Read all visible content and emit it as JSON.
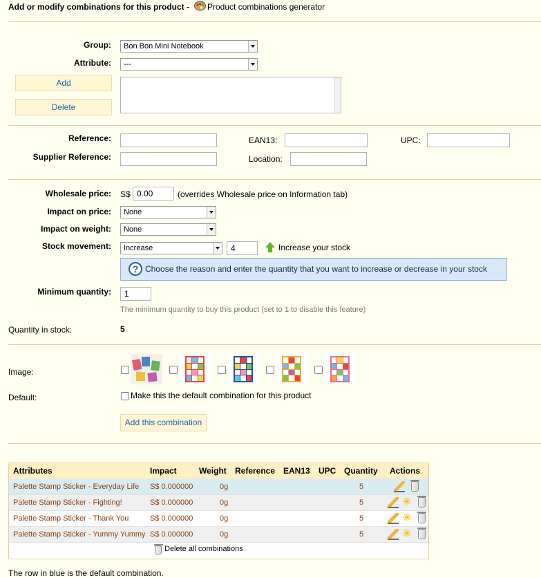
{
  "header": {
    "title": "Add or modify combinations for this product -",
    "generator_link": "Product combinations generator"
  },
  "attributes_section": {
    "group_label": "Group:",
    "group_value": "Bon Bon Mini Notebook",
    "attribute_label": "Attribute:",
    "attribute_value": "---",
    "add_button": "Add",
    "delete_button": "Delete"
  },
  "references": {
    "reference_label": "Reference:",
    "ean13_label": "EAN13:",
    "upc_label": "UPC:",
    "supplier_reference_label": "Supplier Reference:",
    "location_label": "Location:"
  },
  "pricing": {
    "wholesale_label": "Wholesale price:",
    "currency": "S$",
    "wholesale_value": "0.00",
    "wholesale_note": "(overrides Wholesale price on Information tab)",
    "impact_price_label": "Impact on price:",
    "impact_price_value": "None",
    "impact_weight_label": "Impact on weight:",
    "impact_weight_value": "None",
    "stock_movement_label": "Stock movement:",
    "stock_movement_value": "Increase",
    "stock_quantity_value": "4",
    "increase_stock_text": "Increase your stock",
    "hint_text": "Choose the reason and enter the quantity that you want to increase or decrease in your stock",
    "min_quantity_label": "Minimum quantity:",
    "min_quantity_value": "1",
    "min_quantity_help": "The minimum quantity to buy this product (set to 1 to disable this feature)",
    "qty_in_stock_label": "Quantity in stock:",
    "qty_in_stock_value": "5"
  },
  "images_section": {
    "image_label": "Image:",
    "default_label": "Default:",
    "default_checkbox_text": "Make this the default combination for this product",
    "add_combination_button": "Add this combination"
  },
  "table": {
    "headers": [
      "Attributes",
      "Impact",
      "Weight",
      "Reference",
      "EAN13",
      "UPC",
      "Quantity",
      "Actions"
    ],
    "rows": [
      {
        "attributes": "Palette Stamp Sticker - Everyday Life",
        "impact": "S$ 0.000000",
        "weight": "0g",
        "quantity": "5"
      },
      {
        "attributes": "Palette Stamp Sticker - Fighting!",
        "impact": "S$ 0.000000",
        "weight": "0g",
        "quantity": "5"
      },
      {
        "attributes": "Palette Stamp Sticker - Thank You",
        "impact": "S$ 0.000000",
        "weight": "0g",
        "quantity": "5"
      },
      {
        "attributes": "Palette Stamp Sticker - Yummy Yummy",
        "impact": "S$ 0.000000",
        "weight": "0g",
        "quantity": "5"
      }
    ],
    "delete_all": "Delete all combinations"
  },
  "footer_note": "The row in blue is the default combination.",
  "colors": {
    "background": "#fffff0",
    "accent_link": "#2265b2",
    "divider": "#e2cda0",
    "default_row": "#d9ecf2",
    "table_text": "#8a4316"
  },
  "icons": [
    "palette-icon",
    "question-icon",
    "green-up-arrow-icon",
    "pencil-icon",
    "star-icon",
    "trash-icon"
  ]
}
